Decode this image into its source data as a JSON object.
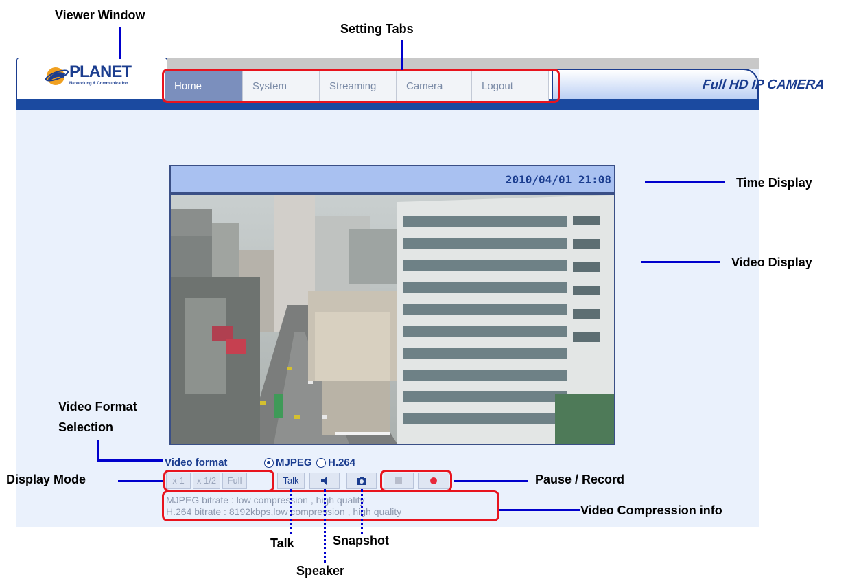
{
  "annotations": {
    "viewer_window": "Viewer Window",
    "setting_tabs": "Setting Tabs",
    "time_display": "Time Display",
    "video_display": "Video Display",
    "video_format_selection_line1": "Video Format",
    "video_format_selection_line2": "Selection",
    "display_mode": "Display Mode",
    "pause_record": "Pause / Record",
    "video_compression_info": "Video Compression info",
    "talk": "Talk",
    "snapshot": "Snapshot",
    "speaker": "Speaker"
  },
  "logo": {
    "name": "PLANET",
    "tagline": "Networking & Communication"
  },
  "banner": "Full HD IP CAMERA",
  "tabs": [
    {
      "label": "Home",
      "active": true
    },
    {
      "label": "System",
      "active": false
    },
    {
      "label": "Streaming",
      "active": false
    },
    {
      "label": "Camera",
      "active": false
    },
    {
      "label": "Logout",
      "active": false
    }
  ],
  "time_display": "2010/04/01 21:08",
  "video_format": {
    "label": "Video format",
    "options": [
      "MJPEG",
      "H.264"
    ],
    "selected": "MJPEG"
  },
  "display_mode": {
    "x1": "x 1",
    "x_half": "x 1/2",
    "full": "Full"
  },
  "talk_button": "Talk",
  "controls": {
    "speaker": "speaker-icon",
    "snapshot": "camera-icon",
    "pause": "stop-icon",
    "record": "record-icon"
  },
  "info": {
    "mjpeg": "MJPEG bitrate : low compression , high quality",
    "h264": "H.264 bitrate : 8192kbps,low compression , high quality"
  },
  "colors": {
    "annotation_line": "#0000cc",
    "highlight": "#e8141e",
    "brand": "#1b3d8f"
  }
}
